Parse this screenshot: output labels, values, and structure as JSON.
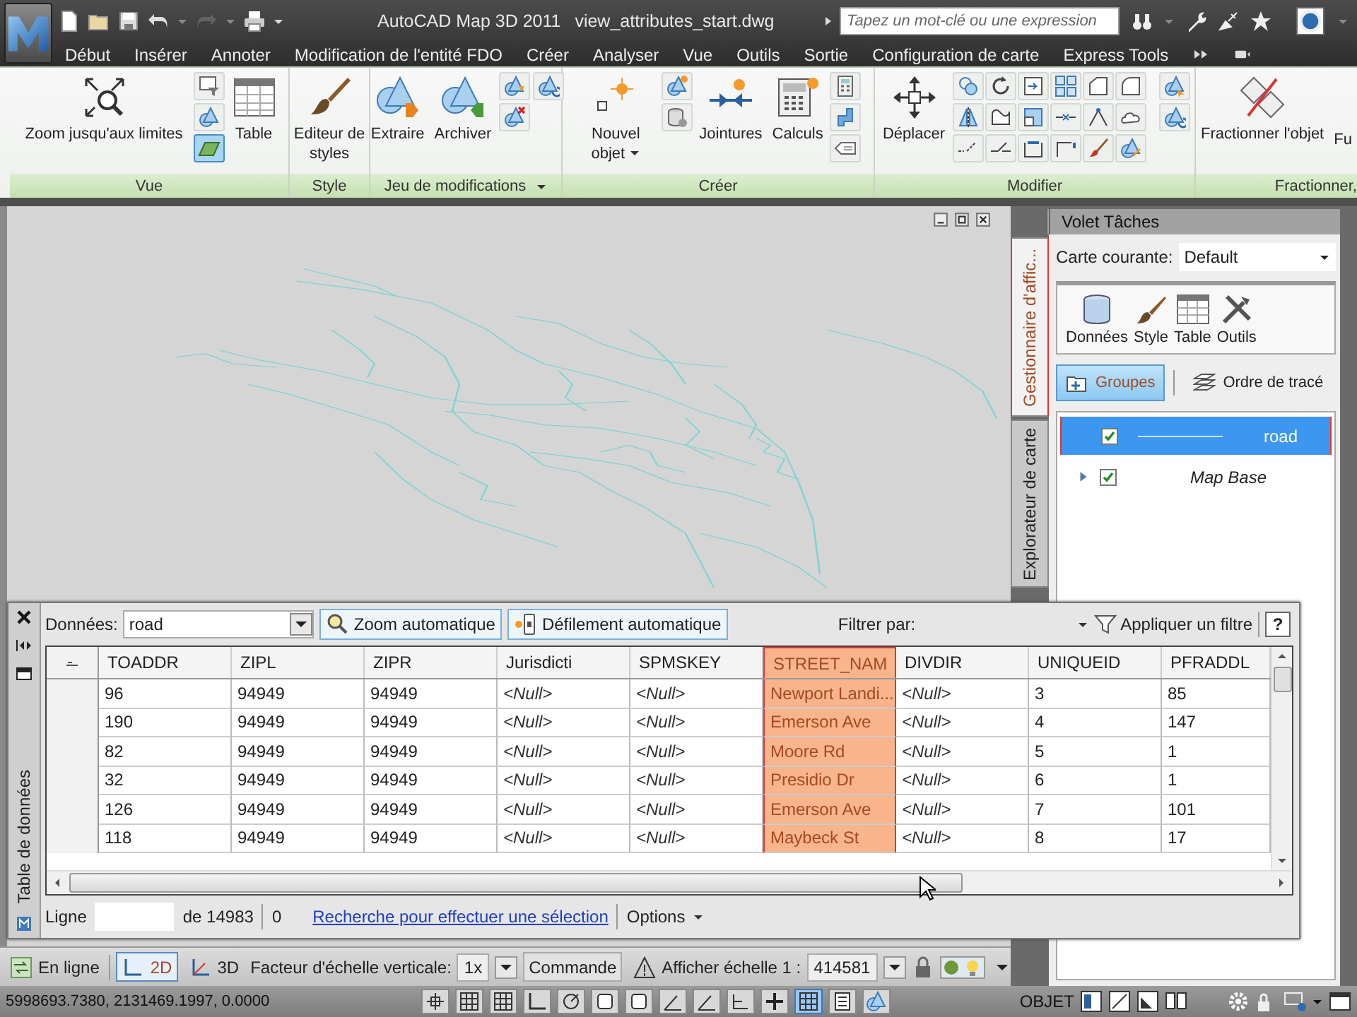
{
  "title_bar": {
    "app_name": "AutoCAD Map 3D 2011",
    "file_name": "view_attributes_start.dwg",
    "search": {
      "placeholder": "Tapez un mot-clé ou une expression"
    }
  },
  "menu_tabs": [
    "Début",
    "Insérer",
    "Annoter",
    "Modification de l'entité FDO",
    "Créer",
    "Analyser",
    "Vue",
    "Outils",
    "Sortie",
    "Configuration de carte",
    "Express Tools"
  ],
  "ribbon": [
    {
      "title": "Vue",
      "menu": false,
      "buttons": [
        {
          "label": "Zoom jusqu'aux limites",
          "menu": false
        },
        {
          "label": "Table",
          "menu": false
        }
      ],
      "tools": [
        {
          "on": false
        },
        {
          "on": false
        },
        {
          "on": true
        }
      ]
    },
    {
      "title": "Style",
      "menu": false,
      "buttons": [
        {
          "label": "Editeur de styles",
          "menu": false
        }
      ]
    },
    {
      "title": "Jeu de modifications",
      "menu": true,
      "buttons": [
        {
          "label": "Extraire",
          "menu": false
        },
        {
          "label": "Archiver",
          "menu": false
        }
      ]
    },
    {
      "title": "Créer",
      "menu": false,
      "buttons": [
        {
          "label": "Nouvel objet",
          "menu": true
        },
        {
          "label": "Jointures",
          "menu": false
        },
        {
          "label": "Calculs",
          "menu": false
        }
      ]
    },
    {
      "title": "Modifier",
      "menu": false,
      "buttons": [
        {
          "label": "Déplacer",
          "menu": false
        }
      ]
    },
    {
      "title": "Fractionner,",
      "menu": false,
      "buttons": [
        {
          "label": "Fractionner l'objet",
          "menu": false
        },
        {
          "label": "Fu",
          "menu": false
        }
      ]
    }
  ],
  "task_pane": {
    "title": "Volet Tâches",
    "side_tabs": [
      {
        "label": "Gestionnaire d'affic...",
        "selected": true
      },
      {
        "label": "Explorateur de carte",
        "selected": false
      }
    ],
    "current_map": {
      "label": "Carte courante:",
      "value": "Default"
    },
    "tools": [
      "Données",
      "Style",
      "Table",
      "Outils"
    ],
    "view_tabs": [
      {
        "label": "Groupes",
        "selected": true
      },
      {
        "label": "Ordre de tracé",
        "selected": false
      }
    ],
    "layers": [
      {
        "name": "road",
        "kind": "layer",
        "checked": true,
        "selected": true
      },
      {
        "name": "Map Base",
        "kind": "group",
        "checked": true,
        "selected": false,
        "expanded": false
      }
    ]
  },
  "data_table": {
    "title": "Table de données",
    "source": {
      "label": "Données:",
      "value": "road"
    },
    "buttons": [
      {
        "label": "Zoom automatique",
        "on": true
      },
      {
        "label": "Défilement automatique",
        "on": true
      }
    ],
    "filter": {
      "label": "Filtrer par:",
      "button": "Appliquer un filtre"
    },
    "help": "?",
    "columns": [
      {
        "name": "TOADDR",
        "selected": false
      },
      {
        "name": "ZIPL",
        "selected": false
      },
      {
        "name": "ZIPR",
        "selected": false
      },
      {
        "name": "Jurisdicti",
        "selected": false
      },
      {
        "name": "SPMSKEY",
        "selected": false
      },
      {
        "name": "STREET_NAM",
        "selected": true
      },
      {
        "name": "DIVDIR",
        "selected": false
      },
      {
        "name": "UNIQUEID",
        "selected": false
      },
      {
        "name": "PFRADDL",
        "selected": false
      }
    ],
    "rows": [
      [
        {
          "text": "96",
          "null": false
        },
        {
          "text": "94949",
          "null": false
        },
        {
          "text": "94949",
          "null": false
        },
        {
          "text": "<Null>",
          "null": true
        },
        {
          "text": "<Null>",
          "null": true
        },
        {
          "text": "Newport Landi...",
          "null": false
        },
        {
          "text": "<Null>",
          "null": true
        },
        {
          "text": "3",
          "null": false
        },
        {
          "text": "85",
          "null": false
        }
      ],
      [
        {
          "text": "190",
          "null": false
        },
        {
          "text": "94949",
          "null": false
        },
        {
          "text": "94949",
          "null": false
        },
        {
          "text": "<Null>",
          "null": true
        },
        {
          "text": "<Null>",
          "null": true
        },
        {
          "text": "Emerson Ave",
          "null": false
        },
        {
          "text": "<Null>",
          "null": true
        },
        {
          "text": "4",
          "null": false
        },
        {
          "text": "147",
          "null": false
        }
      ],
      [
        {
          "text": "82",
          "null": false
        },
        {
          "text": "94949",
          "null": false
        },
        {
          "text": "94949",
          "null": false
        },
        {
          "text": "<Null>",
          "null": true
        },
        {
          "text": "<Null>",
          "null": true
        },
        {
          "text": "Moore Rd",
          "null": false
        },
        {
          "text": "<Null>",
          "null": true
        },
        {
          "text": "5",
          "null": false
        },
        {
          "text": "1",
          "null": false
        }
      ],
      [
        {
          "text": "32",
          "null": false
        },
        {
          "text": "94949",
          "null": false
        },
        {
          "text": "94949",
          "null": false
        },
        {
          "text": "<Null>",
          "null": true
        },
        {
          "text": "<Null>",
          "null": true
        },
        {
          "text": "Presidio Dr",
          "null": false
        },
        {
          "text": "<Null>",
          "null": true
        },
        {
          "text": "6",
          "null": false
        },
        {
          "text": "1",
          "null": false
        }
      ],
      [
        {
          "text": "126",
          "null": false
        },
        {
          "text": "94949",
          "null": false
        },
        {
          "text": "94949",
          "null": false
        },
        {
          "text": "<Null>",
          "null": true
        },
        {
          "text": "<Null>",
          "null": true
        },
        {
          "text": "Emerson Ave",
          "null": false
        },
        {
          "text": "<Null>",
          "null": true
        },
        {
          "text": "7",
          "null": false
        },
        {
          "text": "101",
          "null": false
        }
      ],
      [
        {
          "text": "118",
          "null": false
        },
        {
          "text": "94949",
          "null": false
        },
        {
          "text": "94949",
          "null": false
        },
        {
          "text": "<Null>",
          "null": true
        },
        {
          "text": "<Null>",
          "null": true
        },
        {
          "text": "Maybeck St",
          "null": false
        },
        {
          "text": "<Null>",
          "null": true
        },
        {
          "text": "8",
          "null": false
        },
        {
          "text": "17",
          "null": false
        }
      ]
    ],
    "footer": {
      "row_label": "Ligne",
      "total": "de 14983",
      "selected_count": "0",
      "link": "Recherche pour effectuer une sélection",
      "options": "Options"
    }
  },
  "status_bar": {
    "connection": "En ligne",
    "view_modes": [
      {
        "label": "2D",
        "selected": true
      },
      {
        "label": "3D",
        "selected": false
      }
    ],
    "scale_factor": {
      "label": "Facteur d'échelle verticale:",
      "value": "1x"
    },
    "command": "Commande",
    "display_scale": {
      "label": "Afficher échelle 1 :",
      "value": "414581"
    }
  },
  "coordinates_bar": {
    "coordinates": "5998693.7380, 2131469.1997, 0.0000",
    "toggles": [
      {
        "on": false
      },
      {
        "on": false
      },
      {
        "on": false
      },
      {
        "on": false
      },
      {
        "on": false
      },
      {
        "on": false
      },
      {
        "on": false
      },
      {
        "on": false
      },
      {
        "on": false
      },
      {
        "on": false
      },
      {
        "on": false
      },
      {
        "on": true
      },
      {
        "on": false
      },
      {
        "on": false
      }
    ],
    "space": "OBJET"
  }
}
